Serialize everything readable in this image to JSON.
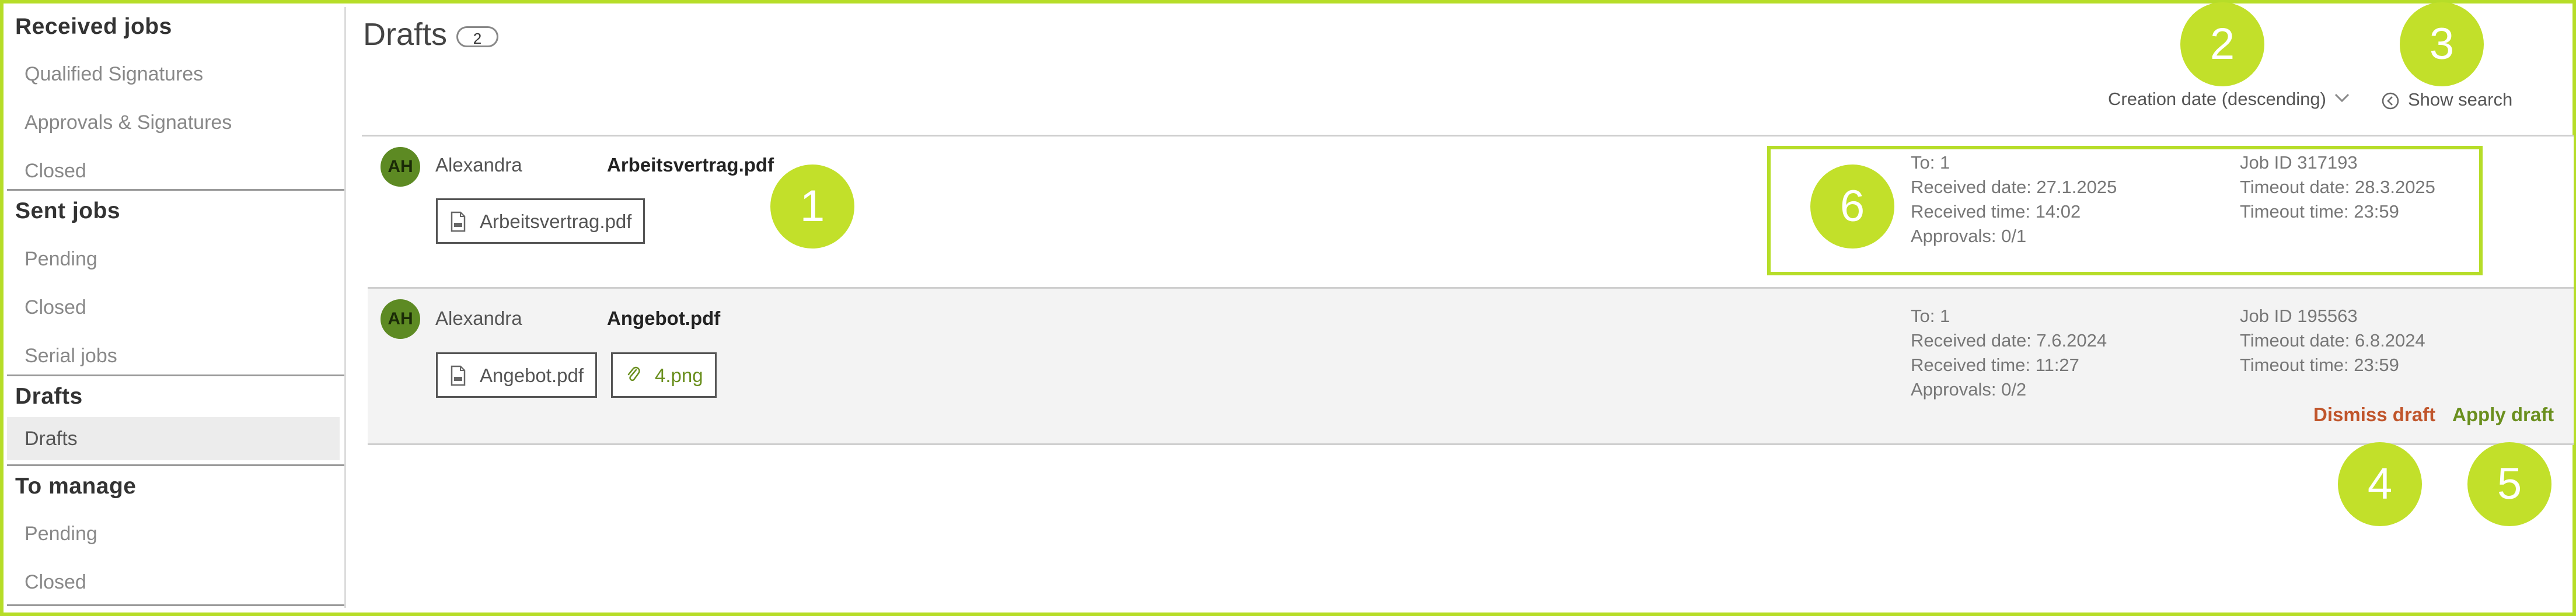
{
  "sidebar": {
    "sections": [
      {
        "title": "Received jobs",
        "items": [
          "Qualified Signatures",
          "Approvals & Signatures",
          "Closed"
        ]
      },
      {
        "title": "Sent jobs",
        "items": [
          "Pending",
          "Closed",
          "Serial jobs"
        ]
      },
      {
        "title": "Drafts",
        "items": [
          "Drafts"
        ]
      },
      {
        "title": "To manage",
        "items": [
          "Pending",
          "Closed"
        ]
      }
    ]
  },
  "header": {
    "title": "Drafts",
    "count": "2",
    "sort_label": "Creation date (descending)",
    "search_label": "Show search"
  },
  "drafts": [
    {
      "initials": "AH",
      "sender": "Alexandra",
      "title": "Arbeitsvertrag.pdf",
      "files": [
        "Arbeitsvertrag.pdf"
      ],
      "to": "To: 1",
      "received_date": "Received date: 27.1.2025",
      "received_time": "Received time: 14:02",
      "approvals": "Approvals: 0/1",
      "job_id": "Job ID 317193",
      "timeout_date": "Timeout date: 28.3.2025",
      "timeout_time": "Timeout time: 23:59"
    },
    {
      "initials": "AH",
      "sender": "Alexandra",
      "title": "Angebot.pdf",
      "files": [
        "Angebot.pdf"
      ],
      "attachment": "4.png",
      "to": "To: 1",
      "received_date": "Received date: 7.6.2024",
      "received_time": "Received time: 11:27",
      "approvals": "Approvals: 0/2",
      "job_id": "Job ID 195563",
      "timeout_date": "Timeout date: 6.8.2024",
      "timeout_time": "Timeout time: 23:59",
      "dismiss_label": "Dismiss draft",
      "apply_label": "Apply draft"
    }
  ],
  "callouts": [
    "1",
    "2",
    "3",
    "4",
    "5",
    "6"
  ],
  "colors": {
    "accent": "#b6dd28",
    "avatar": "#5d8a23",
    "dismiss": "#c0552b",
    "apply": "#6a8f1e"
  }
}
